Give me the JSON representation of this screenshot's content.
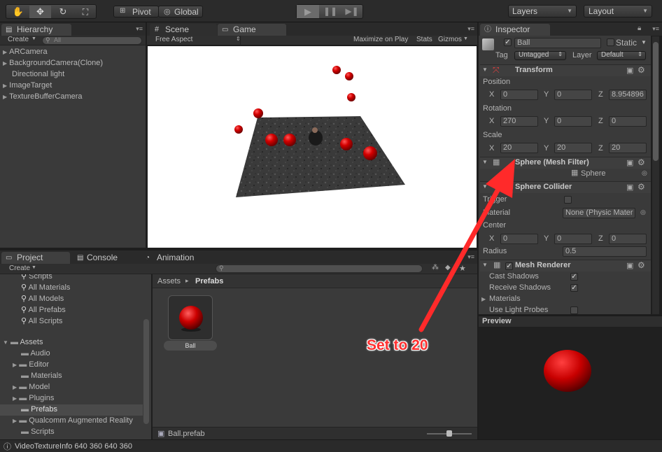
{
  "toolbar": {
    "pivot_label": "Pivot",
    "global_label": "Global",
    "layers_label": "Layers",
    "layout_label": "Layout"
  },
  "hierarchy": {
    "tab_label": "Hierarchy",
    "create_label": "Create",
    "search_placeholder": "All",
    "items": [
      "ARCamera",
      "BackgroundCamera(Clone)",
      "Directional light",
      "ImageTarget",
      "TextureBufferCamera"
    ]
  },
  "scene_tab": {
    "label": "Scene"
  },
  "game": {
    "tab_label": "Game",
    "aspect_label": "Free Aspect",
    "maximize_label": "Maximize on Play",
    "stats_label": "Stats",
    "gizmos_label": "Gizmos"
  },
  "project": {
    "tab_label": "Project",
    "console_label": "Console",
    "animation_label": "Animation",
    "create_label": "Create",
    "favorites": [
      "Scripts",
      "All Materials",
      "All Models",
      "All Prefabs",
      "All Scripts"
    ],
    "assets_label": "Assets",
    "folders": [
      "Audio",
      "Editor",
      "Materials",
      "Model",
      "Plugins",
      "Prefabs",
      "Qualcomm Augmented Reality",
      "Scripts"
    ],
    "breadcrumb_root": "Assets",
    "breadcrumb_sep": "▸",
    "breadcrumb_current": "Prefabs",
    "asset_name": "Ball",
    "footer_file": "Ball.prefab"
  },
  "inspector": {
    "tab_label": "Inspector",
    "object_name": "Ball",
    "static_label": "Static",
    "tag_label": "Tag",
    "tag_value": "Untagged",
    "layer_label": "Layer",
    "layer_value": "Default",
    "transform": {
      "title": "Transform",
      "position_label": "Position",
      "position": {
        "x": "0",
        "y": "0",
        "z": "8.954896"
      },
      "rotation_label": "Rotation",
      "rotation": {
        "x": "270",
        "y": "0",
        "z": "0"
      },
      "scale_label": "Scale",
      "scale": {
        "x": "20",
        "y": "20",
        "z": "20"
      },
      "axis_x": "X",
      "axis_y": "Y",
      "axis_z": "Z"
    },
    "mesh_filter": {
      "title": "Sphere (Mesh Filter)",
      "mesh_value": "Sphere"
    },
    "sphere_collider": {
      "title": "Sphere Collider",
      "trigger_label": "Trigger",
      "material_label": "Material",
      "material_value": "None (Physic Mater",
      "center_label": "Center",
      "center": {
        "x": "0",
        "y": "0",
        "z": "0"
      },
      "radius_label": "Radius",
      "radius_value": "0.5"
    },
    "mesh_renderer": {
      "title": "Mesh Renderer",
      "cast_shadows_label": "Cast Shadows",
      "receive_shadows_label": "Receive Shadows",
      "materials_label": "Materials",
      "light_probes_label": "Use Light Probes"
    },
    "preview_label": "Preview"
  },
  "annotation": {
    "text": "Set to 20"
  },
  "status_bar": {
    "text": "VideoTextureInfo 640 360 640 360"
  },
  "colors": {
    "ball_red": "#d40000",
    "annotation_red": "#ff2a2a",
    "panel_bg": "#383838"
  }
}
